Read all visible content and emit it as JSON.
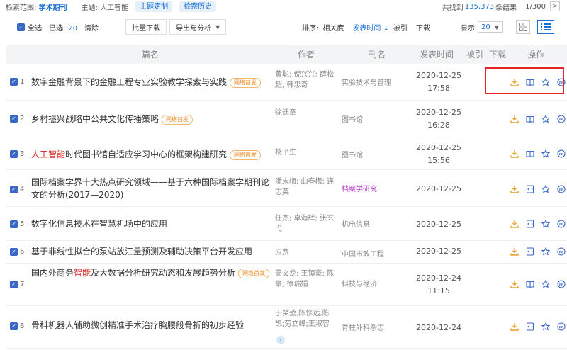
{
  "top": {
    "scope_label": "检索范围:",
    "scope_value": "学术期刊",
    "topic_label": "主题:",
    "topic_value": "人工智能",
    "chip_custom": "主题定制",
    "chip_history": "检索历史",
    "found_prefix": "共找到",
    "found_count": "135,373",
    "found_suffix": "条结果",
    "page": "1/300",
    "next": ">"
  },
  "toolbar": {
    "select_all": "全选",
    "selected_label": "已选:",
    "selected_count": "20",
    "clear": "清除",
    "bulk_download": "批量下载",
    "export_analyze": "导出与分析",
    "sort_label": "排序:",
    "sort_relevance": "相关度",
    "sort_date": "发表时间",
    "sort_cited": "被引",
    "sort_download": "下载",
    "show_label": "显示",
    "show_value": "20"
  },
  "columns": [
    "篇名",
    "作者",
    "刊名",
    "发表时间",
    "被引",
    "下载",
    "操作"
  ],
  "rows": [
    {
      "idx": "1",
      "pre": "数字金融背景下的金融工程专业实验教学探索与实践",
      "hl": "",
      "post": "",
      "badge": "网络首发",
      "author": "黄聪; 倪兴兴; 薛松超; 韩忠奇",
      "journal": "实验技术与管理",
      "date": "2020-12-25",
      "time": "17:58"
    },
    {
      "idx": "2",
      "pre": "乡村振兴战略中公共文化传播策略",
      "hl": "",
      "post": "",
      "badge": "网络首发",
      "author": "徐廷章",
      "journal": "图书馆",
      "date": "2020-12-25",
      "time": "16:28"
    },
    {
      "idx": "3",
      "pre": "",
      "hl": "人工智能",
      "post": "时代图书馆自适应学习中心的框架构建研究",
      "badge": "网络首发",
      "author": "杨平生",
      "journal": "图书馆",
      "date": "2020-12-25",
      "time": "15:56"
    },
    {
      "idx": "4",
      "pre": "国际档案学界十大热点研究领域——基于六种国际档案学期刊论文的分析(2017—2020)",
      "hl": "",
      "post": "",
      "badge": "",
      "author": "潘未梅; 曲春梅; 连志英",
      "journal": "档案学研究",
      "date": "2020-12-25",
      "time": ""
    },
    {
      "idx": "5",
      "pre": "数字化信息技术在智慧机场中的应用",
      "hl": "",
      "post": "",
      "badge": "",
      "author": "任杰; 卓海辉; 张玄弋",
      "journal": "机电信息",
      "date": "2020-12-25",
      "time": ""
    },
    {
      "idx": "6",
      "pre": "基于非线性拟合的泵站放江量预测及辅助决策平台开发应用",
      "hl": "",
      "post": "",
      "badge": "",
      "author": "应费",
      "journal": "中国市政工程",
      "date": "2020-12-25",
      "time": ""
    },
    {
      "idx": "7",
      "pre": "国内外商务",
      "hl": "智能",
      "post": "及大数据分析研究动态和发展趋势分析",
      "badge": "网络首发",
      "author": "萧文龙; 王镇豪; 陈豪; 徐瑞娟",
      "journal": "科技与经济",
      "date": "2020-12-24",
      "time": "11:15"
    },
    {
      "idx": "8",
      "pre": "骨科机器人辅助微创精准手术治疗胸腰段骨折的初步经验",
      "hl": "",
      "post": "",
      "badge": "",
      "author": "于癸堃;陈修远;陈凯;劳立峰;王淑容",
      "journal": "脊柱外科杂志",
      "date": "2020-12-24",
      "time": ""
    }
  ],
  "expand_glyph": "›",
  "accent": "#1a6fd6",
  "highlight_color": "#e52626",
  "icons": [
    "download-icon",
    "read-icon",
    "favorite-icon",
    "quote-icon"
  ]
}
